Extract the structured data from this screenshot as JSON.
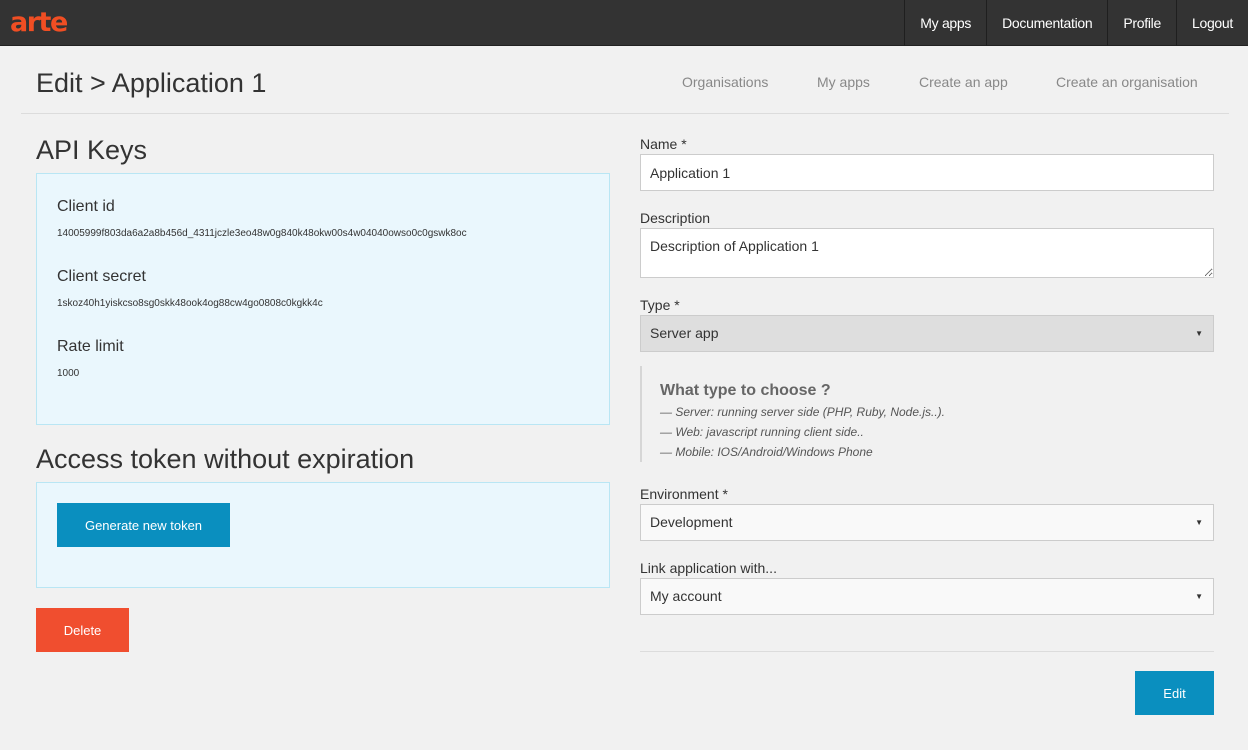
{
  "topbar": {
    "logo": "arte",
    "nav": [
      "My apps",
      "Documentation",
      "Profile",
      "Logout"
    ]
  },
  "header": {
    "title": "Edit > Application 1",
    "subnav": [
      "Organisations",
      "My apps",
      "Create an app",
      "Create an organisation"
    ]
  },
  "api_keys": {
    "heading": "API Keys",
    "client_id_label": "Client id",
    "client_id": "14005999f803da6a2a8b456d_4311jczle3eo48w0g840k48okw00s4w04040owso0c0gswk8oc",
    "client_secret_label": "Client secret",
    "client_secret": "1skoz40h1yiskcso8sg0skk48ook4og88cw4go0808c0kgkk4c",
    "rate_limit_label": "Rate limit",
    "rate_limit": "1000"
  },
  "token": {
    "heading": "Access token without expiration",
    "generate_label": "Generate new token"
  },
  "delete_label": "Delete",
  "form": {
    "name_label": "Name *",
    "name_value": "Application 1",
    "description_label": "Description",
    "description_value": "Description of Application 1",
    "type_label": "Type *",
    "type_value": "Server app",
    "help_title": "What type to choose ?",
    "help_lines": [
      "— Server: running server side (PHP, Ruby, Node.js..).",
      "— Web: javascript running client side..",
      "— Mobile: IOS/Android/Windows Phone"
    ],
    "environment_label": "Environment *",
    "environment_value": "Development",
    "link_label": "Link application with...",
    "link_value": "My account",
    "edit_label": "Edit"
  },
  "colors": {
    "topbar": "#333333",
    "logo": "#f04e23",
    "primary_button": "#0a8fbf",
    "danger_button": "#f04e2f",
    "panel_bg": "#eaf7fd",
    "panel_border": "#b9e6f4"
  }
}
